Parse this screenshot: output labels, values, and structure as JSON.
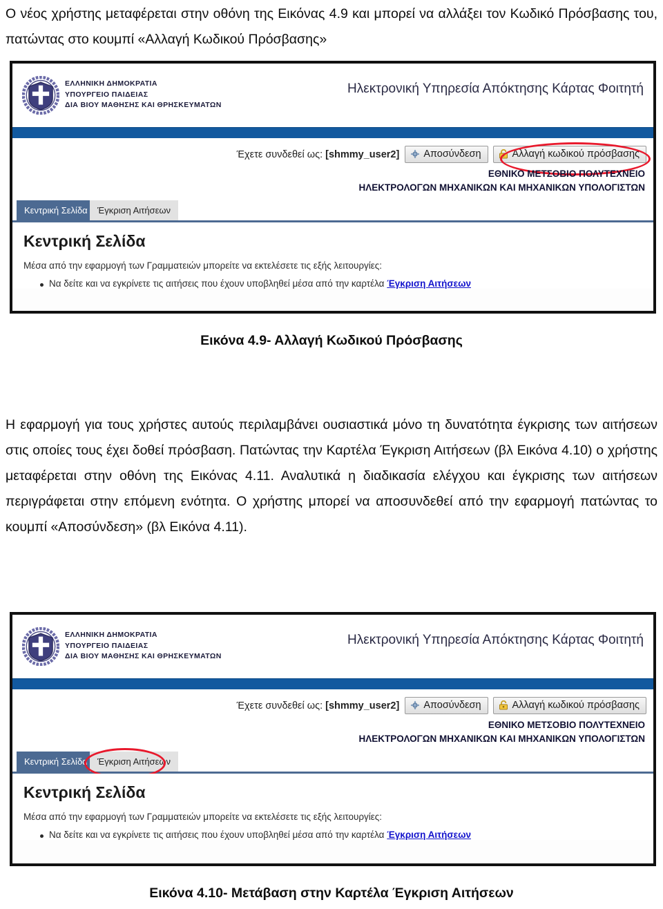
{
  "document": {
    "intro_paragraph": "Ο νέος χρήστης μεταφέρεται στην οθόνη της Εικόνας 4.9 και μπορεί να αλλάξει τον Κωδικό Πρόσβασης του, πατώντας στο κουμπί «Αλλαγή Κωδικού Πρόσβασης»",
    "caption_fig_49": "Εικόνα 4.9- Αλλαγή Κωδικού Πρόσβασης",
    "body_paragraph": "Η εφαρμογή για τους χρήστες αυτούς περιλαμβάνει ουσιαστικά μόνο τη δυνατότητα έγκρισης των αιτήσεων στις οποίες τους έχει δοθεί πρόσβαση. Πατώντας την Καρτέλα Έγκριση Αιτήσεων (βλ Εικόνα 4.10) ο χρήστης μεταφέρεται στην οθόνη της Εικόνας 4.11. Αναλυτικά η διαδικασία ελέγχου και έγκρισης των αιτήσεων περιγράφεται στην επόμενη ενότητα. Ο χρήστης μπορεί να αποσυνδεθεί από την εφαρμογή πατώντας το κουμπί «Αποσύνδεση» (βλ Εικόνα 4.11).",
    "caption_fig_410": "Εικόνα 4.10- Μετάβαση στην Καρτέλα Έγκριση Αιτήσεων"
  },
  "screenshot": {
    "header": {
      "emblem_name": "greek-republic-emblem",
      "ministry_line1": "ΕΛΛΗΝΙΚΗ ΔΗΜΟΚΡΑΤΙΑ",
      "ministry_line2": "ΥΠΟΥΡΓΕΙΟ ΠΑΙΔΕΙΑΣ",
      "ministry_line3": "ΔΙΑ ΒΙΟΥ ΜΑΘΗΣΗΣ ΚΑΙ ΘΡΗΣΚΕΥΜΑΤΩΝ",
      "service_title": "Ηλεκτρονική Υπηρεσία Απόκτησης Κάρτας Φοιτητή"
    },
    "toolbar": {
      "logged_in_prefix": "Έχετε συνδεθεί ως:",
      "username": "[shmmy_user2]",
      "logout_label": "Αποσύνδεση",
      "logout_icon": "logout-icon",
      "change_password_label": "Αλλαγή κωδικού πρόσβασης",
      "change_password_icon": "lock-icon",
      "institution_line1": "ΕΘΝΙΚΟ ΜΕΤΣΟΒΙΟ ΠΟΛΥΤΕΧΝΕΙΟ",
      "institution_line2": "ΗΛΕΚΤΡΟΛΟΓΩΝ ΜΗΧΑΝΙΚΩΝ ΚΑΙ ΜΗΧΑΝΙΚΩΝ ΥΠΟΛΟΓΙΣΤΩΝ"
    },
    "tabs": {
      "home_label": "Κεντρική Σελίδα",
      "approvals_label": "Έγκριση Αιτήσεων"
    },
    "content": {
      "page_title": "Κεντρική Σελίδα",
      "intro": "Μέσα από την εφαρμογή των Γραμματειών μπορείτε να εκτελέσετε τις εξής λειτουργίες:",
      "bullet_text": "Να δείτε και να εγκρίνετε τις αιτήσεις που έχουν υποβληθεί μέσα από την καρτέλα",
      "bullet_link": "Έγκριση Αιτήσεων"
    }
  },
  "colors": {
    "brand_blue": "#12599f",
    "tab_active": "#4c6a92",
    "annotation_red": "#e8192c",
    "link_blue": "#1212cc"
  }
}
